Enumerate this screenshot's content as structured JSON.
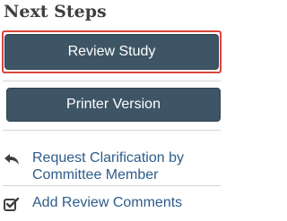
{
  "next_steps": {
    "title": "Next Steps",
    "buttons": {
      "review_study": "Review Study",
      "printer_version": "Printer Version"
    },
    "actions": [
      {
        "label": "Request Clarification by Committee Member",
        "icon": "reply-arrow-icon"
      },
      {
        "label": "Add Review Comments",
        "icon": "checkbox-check-icon"
      }
    ],
    "colors": {
      "button_bg": "#3e5566",
      "highlight": "#d9453d",
      "link": "#2e5c8a",
      "title": "#3f3f3f"
    }
  }
}
